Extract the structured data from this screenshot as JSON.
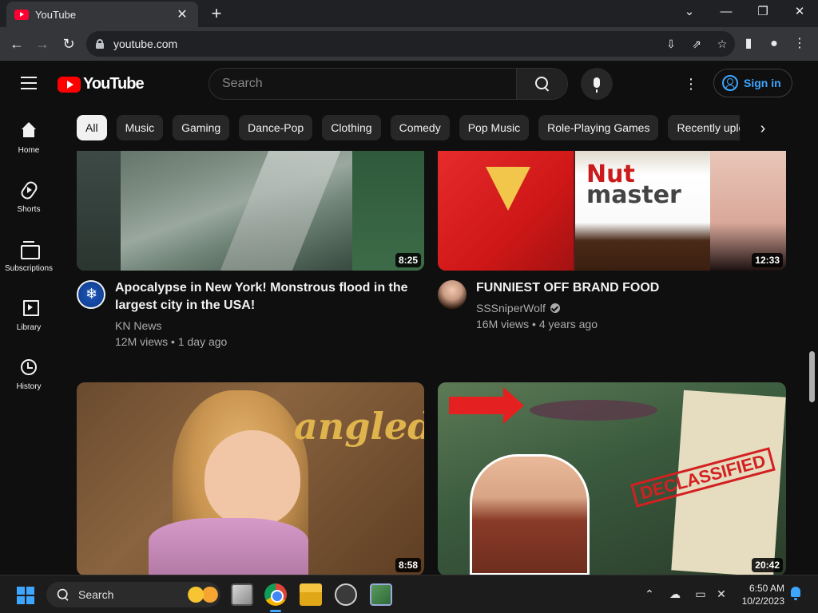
{
  "browser": {
    "tab_title": "YouTube",
    "new_tab": "+",
    "url": "youtube.com"
  },
  "yt_header": {
    "logo_text": "YouTube",
    "search_placeholder": "Search",
    "signin_label": "Sign in"
  },
  "chips": [
    "All",
    "Music",
    "Gaming",
    "Dance-Pop",
    "Clothing",
    "Comedy",
    "Pop Music",
    "Role-Playing Games",
    "Recently uploaded"
  ],
  "guide": [
    {
      "label": "Home",
      "icon": "home-icon"
    },
    {
      "label": "Shorts",
      "icon": "shorts-icon"
    },
    {
      "label": "Subscriptions",
      "icon": "subscriptions-icon"
    },
    {
      "label": "Library",
      "icon": "library-icon"
    },
    {
      "label": "History",
      "icon": "history-icon"
    }
  ],
  "videos": [
    {
      "title_line1": "Apocalypse in New York! Monstrous flood in the",
      "title_line2": "largest city in the USA!",
      "channel": "KN News",
      "views": "12M views",
      "age": "1 day ago",
      "duration": "8:25",
      "verified": false
    },
    {
      "title_line1": "FUNNIEST OFF BRAND FOOD",
      "title_line2": "",
      "channel": "SSSniperWolf",
      "views": "16M views",
      "age": "4 years ago",
      "duration": "12:33",
      "verified": true,
      "thumb_text_1": "Nut",
      "thumb_text_2": "master"
    },
    {
      "duration": "8:58",
      "thumb_text": "angled"
    },
    {
      "duration": "20:42",
      "thumb_text": "DECLASSIFIED"
    }
  ],
  "taskbar": {
    "search_label": "Search",
    "time": "6:50 AM",
    "date": "10/2/2023"
  },
  "colors": {
    "page_bg": "#0f0f0f",
    "accent_blue": "#3ea6ff",
    "yt_red": "#ff0000"
  }
}
